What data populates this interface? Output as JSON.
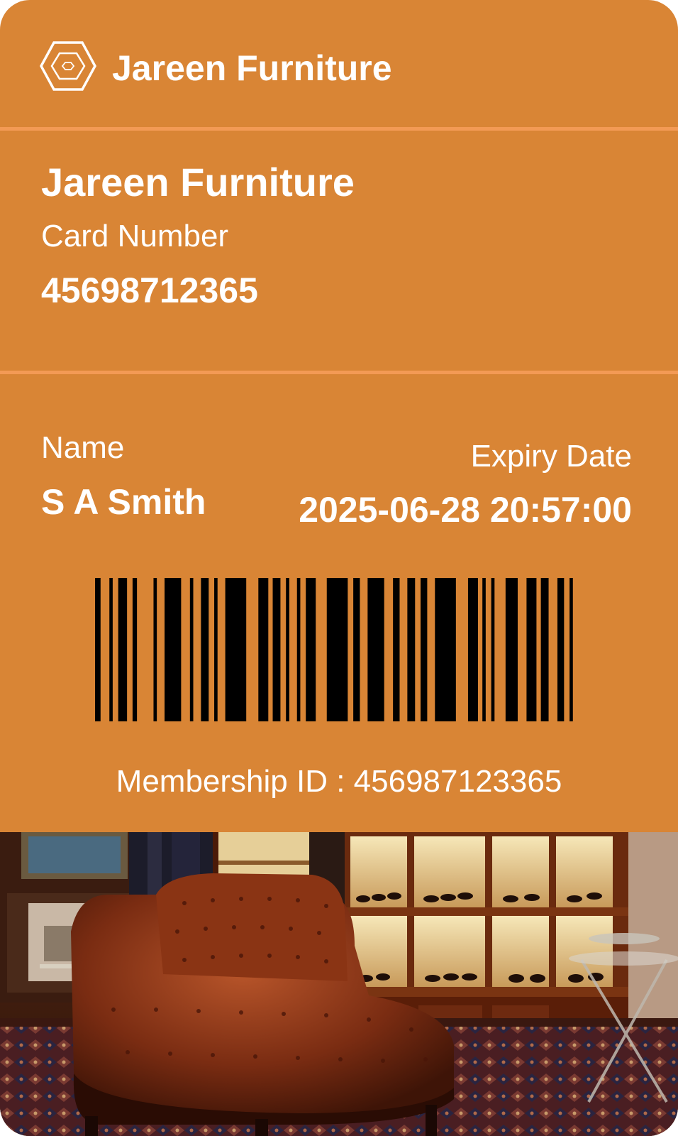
{
  "header": {
    "logo_icon": "hexagon-logo-icon",
    "title": "Jareen Furniture"
  },
  "card": {
    "store_name": "Jareen Furniture",
    "card_number_label": "Card Number",
    "card_number": "45698712365",
    "name_label": "Name",
    "name": "S A Smith",
    "expiry_label": "Expiry Date",
    "expiry": "2025-06-28 20:57:00",
    "membership_id": "Membership ID : 456987123365"
  },
  "barcode": {
    "value": "456987123365"
  },
  "photo": {
    "subject": "furniture-showroom-chesterfield-sofa"
  },
  "colors": {
    "card_background": "#d98535",
    "divider": "#f39a55",
    "text": "#ffffff",
    "barcode": "#000000"
  }
}
